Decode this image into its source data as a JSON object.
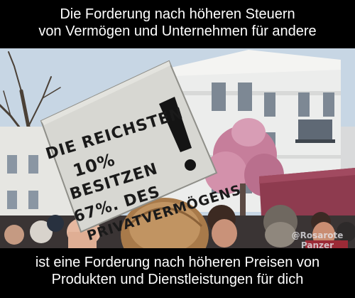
{
  "caption_top": {
    "line1": "Die Forderung nach höheren Steuern",
    "line2": "von Vermögen und Unternehmen für andere"
  },
  "caption_bottom": {
    "line1": "ist eine Forderung nach höheren Preisen von",
    "line2": "Produkten und Dienstleistungen für dich"
  },
  "sign": {
    "line1": "DIE REICHSTEN",
    "line2": "10%",
    "line3": "BESITZEN",
    "line4": "67%. DES",
    "line5": "PRIVATVERMÖGENS"
  },
  "watermark": {
    "handle": "@Rosarote",
    "name": "Panzer"
  },
  "colors": {
    "caption_bg": "#000000",
    "caption_text": "#ffffff",
    "sky": "#c9d7e4",
    "building": "#e9ecef",
    "cardboard": "#d9d9d4",
    "blossom": "#c97c9a"
  }
}
